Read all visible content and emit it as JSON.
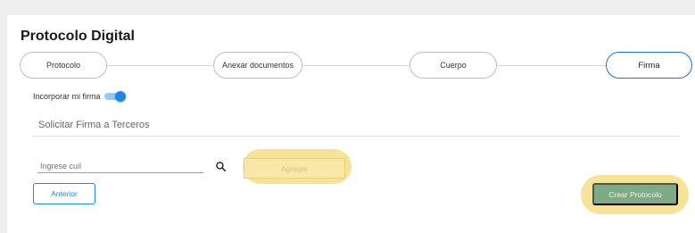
{
  "page": {
    "title": "Protocolo Digital"
  },
  "stepper": {
    "steps": [
      {
        "label": "Protocolo",
        "active": false
      },
      {
        "label": "Anexar documentos",
        "active": false
      },
      {
        "label": "Cuerpo",
        "active": false
      },
      {
        "label": "Firma",
        "active": true
      }
    ]
  },
  "signature": {
    "toggle_label": "Incorporar mi firma",
    "toggle_on": true
  },
  "third_party": {
    "heading": "Solicitar Firma a Terceros",
    "cuil_placeholder": "Ingrese cuil",
    "cuil_value": "",
    "add_label": "Agregar",
    "search_icon": "search-icon"
  },
  "actions": {
    "back_label": "Anterior",
    "create_label": "Crear Protocolo"
  },
  "colors": {
    "accent": "#1e88e5",
    "highlight": "#f5e28f",
    "create_button": "#7cab86"
  }
}
